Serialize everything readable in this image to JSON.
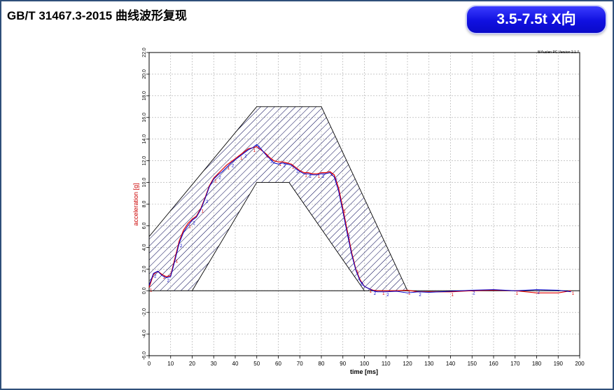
{
  "header": {
    "title": "GB/T 31467.3-2015 曲线波形复现",
    "badge": "3.5-7.5t X向"
  },
  "colors": {
    "frame": "#2f4f7a",
    "badge": "#1a1aee",
    "acceleration_line": "#e00000",
    "measured_line": "#0000cc",
    "hatch": "#000050",
    "ylabel_color": "#cc0000"
  },
  "chart_data": {
    "type": "line",
    "title": "",
    "version_note": "B/Auslen PC Version 2.1.7",
    "xlabel": "time [ms]",
    "ylabel": "acceleration [g]",
    "xlim": [
      0,
      200
    ],
    "ylim": [
      -6,
      22
    ],
    "grid": true,
    "x_ticks": [
      0,
      10,
      20,
      30,
      40,
      50,
      60,
      70,
      80,
      90,
      100,
      110,
      120,
      130,
      140,
      150,
      160,
      170,
      180,
      190,
      200
    ],
    "y_ticks": [
      -6,
      -4,
      -2,
      0,
      2,
      4,
      6,
      8,
      10,
      12,
      14,
      16,
      18,
      20,
      22
    ],
    "corridor_upper": {
      "x": [
        0,
        50,
        80,
        120
      ],
      "y": [
        5,
        17,
        17,
        0
      ]
    },
    "corridor_lower": {
      "x": [
        20,
        50,
        65,
        100
      ],
      "y": [
        0,
        10,
        10,
        0
      ]
    },
    "series": [
      {
        "x": [
          0,
          2,
          4,
          6,
          8,
          10,
          12,
          14,
          16,
          18,
          20,
          22,
          24,
          26,
          28,
          30,
          32,
          34,
          36,
          38,
          40,
          42,
          44,
          46,
          48,
          50,
          52,
          54,
          56,
          58,
          60,
          62,
          64,
          66,
          68,
          70,
          72,
          74,
          76,
          78,
          80,
          82,
          84,
          86,
          88,
          90,
          92,
          94,
          96,
          98,
          100,
          102,
          104,
          106,
          108,
          110,
          115,
          120,
          125,
          130,
          140,
          150,
          160,
          170,
          180,
          190,
          196
        ],
        "y": [
          0.3,
          1.5,
          1.8,
          1.5,
          1.3,
          1.4,
          3.0,
          4.6,
          5.6,
          6.2,
          6.6,
          6.9,
          7.6,
          8.6,
          9.7,
          10.4,
          10.8,
          11.2,
          11.6,
          11.9,
          12.2,
          12.5,
          12.8,
          13.1,
          13.2,
          13.3,
          13.0,
          12.7,
          12.3,
          12.0,
          11.9,
          11.9,
          11.8,
          11.7,
          11.4,
          11.1,
          10.9,
          10.9,
          10.8,
          10.8,
          10.9,
          10.9,
          11.0,
          10.7,
          9.5,
          7.6,
          5.6,
          3.6,
          2.0,
          1.0,
          0.4,
          0.2,
          0.05,
          0.0,
          0.0,
          0.0,
          0.0,
          0.05,
          -0.1,
          -0.1,
          -0.1,
          0.0,
          0.05,
          0.0,
          -0.2,
          -0.2,
          0.0
        ]
      },
      {
        "x": [
          0,
          2,
          4,
          6,
          8,
          10,
          12,
          14,
          16,
          18,
          20,
          22,
          24,
          26,
          28,
          30,
          32,
          34,
          36,
          38,
          40,
          42,
          44,
          46,
          48,
          50,
          52,
          54,
          56,
          58,
          60,
          62,
          64,
          66,
          68,
          70,
          72,
          74,
          76,
          78,
          80,
          82,
          84,
          86,
          88,
          90,
          92,
          94,
          96,
          98,
          100,
          102,
          104,
          106,
          108,
          110,
          115,
          120,
          125,
          130,
          140,
          150,
          160,
          170,
          180,
          190,
          196
        ],
        "y": [
          0.5,
          1.6,
          1.8,
          1.4,
          1.2,
          1.3,
          2.8,
          4.4,
          5.4,
          6.0,
          6.5,
          6.8,
          7.5,
          8.5,
          9.6,
          10.3,
          10.7,
          11.0,
          11.4,
          11.8,
          12.1,
          12.4,
          12.7,
          13.0,
          13.2,
          13.5,
          13.1,
          12.6,
          12.2,
          11.8,
          11.7,
          11.8,
          11.7,
          11.6,
          11.3,
          11.0,
          10.8,
          10.8,
          10.7,
          10.7,
          10.8,
          10.8,
          10.9,
          10.5,
          9.2,
          7.3,
          5.3,
          3.4,
          1.9,
          0.9,
          0.4,
          0.2,
          0.0,
          -0.1,
          -0.1,
          -0.1,
          -0.05,
          -0.2,
          -0.1,
          -0.15,
          -0.05,
          0.05,
          0.1,
          0.0,
          0.1,
          0.05,
          -0.1
        ]
      }
    ]
  }
}
